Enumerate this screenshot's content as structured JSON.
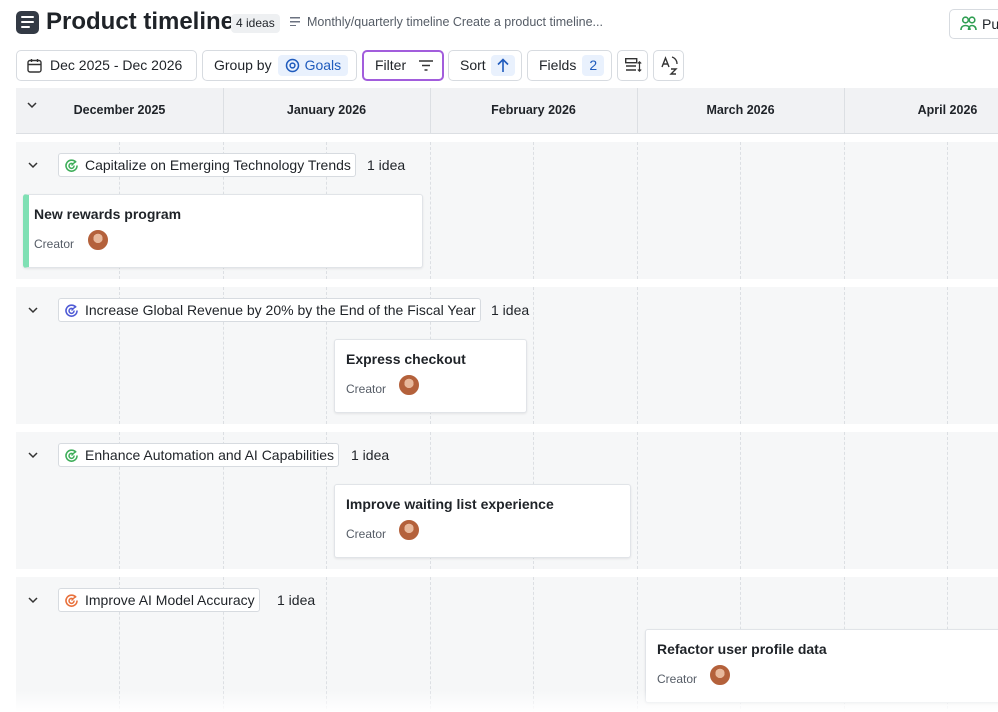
{
  "header": {
    "title": "Product timeline",
    "count_badge": "4 ideas",
    "description": "Monthly/quarterly timeline Create a product timeline...",
    "publish_label": "Pu"
  },
  "toolbar": {
    "date_range": "Dec 2025 - Dec 2026",
    "group_by_label": "Group by",
    "group_by_value": "Goals",
    "filter_label": "Filter",
    "sort_label": "Sort",
    "fields_label": "Fields",
    "fields_count": "2"
  },
  "timeline": {
    "months": [
      "December 2025",
      "January 2026",
      "February 2026",
      "March 2026",
      "April 2026"
    ]
  },
  "groups": [
    {
      "goal": "Capitalize on Emerging Technology Trends",
      "goal_icon_color": "#3fae5a",
      "count": "1 idea",
      "cards": [
        {
          "title": "New rewards program",
          "creator_label": "Creator",
          "accent_color": "#7fe0b4"
        }
      ]
    },
    {
      "goal": "Increase Global Revenue by 20% by the End of the Fiscal Year",
      "goal_icon_color": "#4f5bd5",
      "count": "1 idea",
      "cards": [
        {
          "title": "Express checkout",
          "creator_label": "Creator"
        }
      ]
    },
    {
      "goal": "Enhance Automation and AI Capabilities",
      "goal_icon_color": "#3fae5a",
      "count": "1 idea",
      "cards": [
        {
          "title": "Improve waiting list experience",
          "creator_label": "Creator"
        }
      ]
    },
    {
      "goal": "Improve AI Model Accuracy",
      "goal_icon_color": "#e8713c",
      "count": "1 idea",
      "cards": [
        {
          "title": "Refactor user profile data",
          "creator_label": "Creator"
        }
      ]
    }
  ]
}
